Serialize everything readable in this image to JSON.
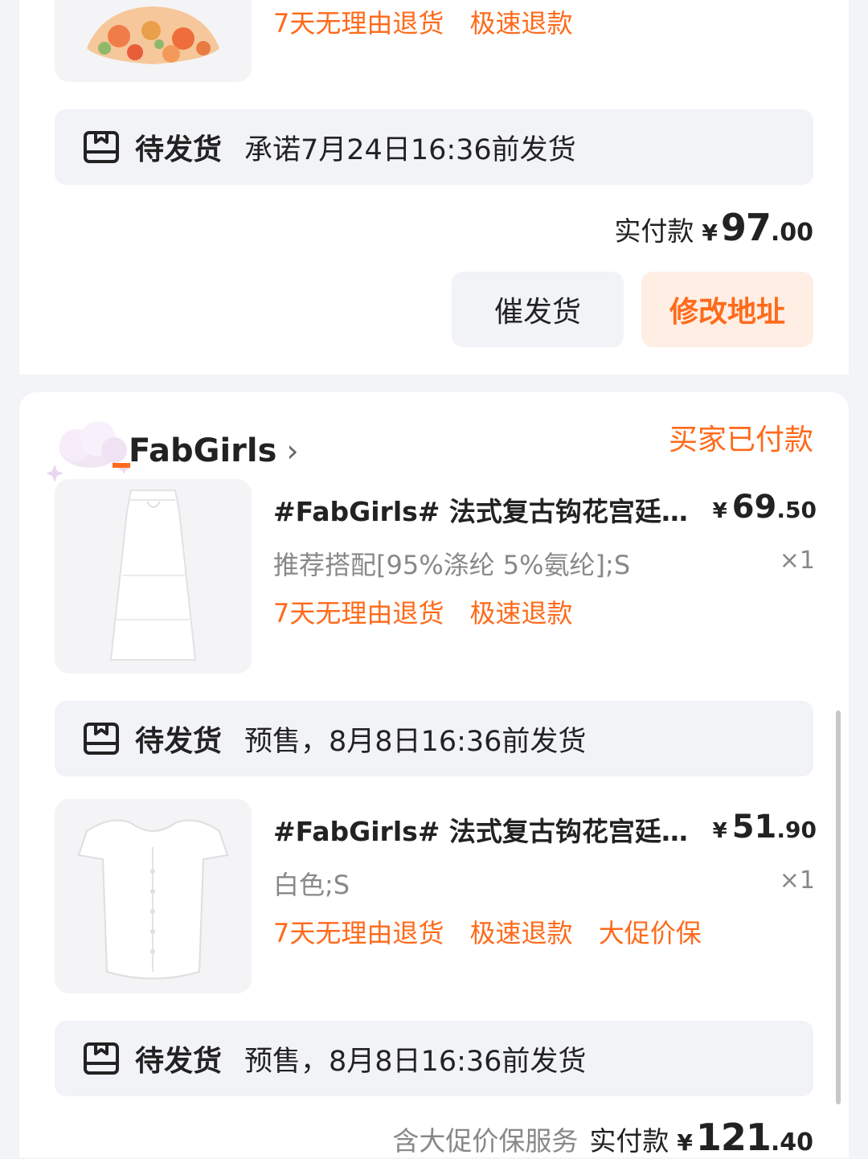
{
  "previous_order": {
    "tags": [
      "7天无理由退货",
      "极速退款"
    ],
    "shipping": {
      "status": "待发货",
      "text": "承诺7月24日16:36前发货"
    },
    "paid": {
      "label": "实付款",
      "currency": "¥",
      "integer": "97",
      "decimal": ".00"
    },
    "buttons": {
      "urge": "催发货",
      "change_address": "修改地址"
    }
  },
  "order": {
    "shop_name": "FabGirls",
    "status": "买家已付款",
    "items": [
      {
        "title": "#FabGirls# 法式复古钩花宫廷…",
        "price": {
          "currency": "¥",
          "integer": "69",
          "decimal": ".50"
        },
        "spec": "推荐搭配[95%涤纶 5%氨纶];S",
        "qty": "×1",
        "tags": [
          "7天无理由退货",
          "极速退款"
        ],
        "shipping": {
          "status": "待发货",
          "text": "预售，8月8日16:36前发货"
        }
      },
      {
        "title": "#FabGirls# 法式复古钩花宫廷…",
        "price": {
          "currency": "¥",
          "integer": "51",
          "decimal": ".90"
        },
        "spec": "白色;S",
        "qty": "×1",
        "tags": [
          "7天无理由退货",
          "极速退款",
          "大促价保"
        ],
        "shipping": {
          "status": "待发货",
          "text": "预售，8月8日16:36前发货"
        }
      }
    ],
    "footer": {
      "guarantee": "含大促价保服务",
      "paid_label": "实付款",
      "currency": "¥",
      "integer": "121",
      "decimal": ".40"
    }
  },
  "colors": {
    "accent": "#ff6a1a",
    "bar_bg": "#f1f3f7",
    "page_bg": "#f3f4f7"
  },
  "icons": [
    "package-icon",
    "chevron-right-icon",
    "cloud-sticker-icon"
  ]
}
